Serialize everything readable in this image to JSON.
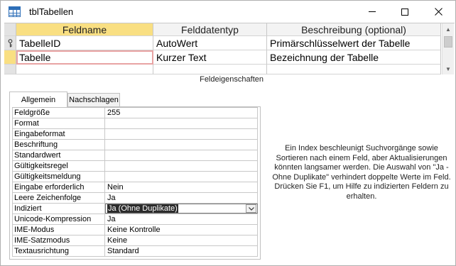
{
  "window": {
    "title": "tblTabellen",
    "icon": "table-icon"
  },
  "grid": {
    "headers": [
      "Feldname",
      "Felddatentyp",
      "Beschreibung (optional)"
    ],
    "rows": [
      {
        "field": "TabelleID",
        "type": "AutoWert",
        "description": "Primärschlüsselwert der Tabelle",
        "primary_key": true
      },
      {
        "field": "Tabelle",
        "type": "Kurzer Text",
        "description": "Bezeichnung der Tabelle",
        "primary_key": false
      }
    ],
    "accent_color": "#f9df82"
  },
  "section_label": "Feldeigenschaften",
  "tabs": {
    "general": "Allgemein",
    "lookup": "Nachschlagen"
  },
  "properties": [
    {
      "name": "Feldgröße",
      "value": "255"
    },
    {
      "name": "Format",
      "value": ""
    },
    {
      "name": "Eingabeformat",
      "value": ""
    },
    {
      "name": "Beschriftung",
      "value": ""
    },
    {
      "name": "Standardwert",
      "value": ""
    },
    {
      "name": "Gültigkeitsregel",
      "value": ""
    },
    {
      "name": "Gültigkeitsmeldung",
      "value": ""
    },
    {
      "name": "Eingabe erforderlich",
      "value": "Nein"
    },
    {
      "name": "Leere Zeichenfolge",
      "value": "Ja"
    },
    {
      "name": "Indiziert",
      "value": "Ja (Ohne Duplikate)"
    },
    {
      "name": "Unicode-Kompression",
      "value": "Ja"
    },
    {
      "name": "IME-Modus",
      "value": "Keine Kontrolle"
    },
    {
      "name": "IME-Satzmodus",
      "value": "Keine"
    },
    {
      "name": "Textausrichtung",
      "value": "Standard"
    }
  ],
  "help_text": "Ein Index beschleunigt Suchvorgänge sowie Sortieren nach einem Feld, aber Aktualisierungen könnten langsamer werden. Die Auswahl von \"Ja - Ohne Duplikate\" verhindert doppelte Werte im Feld. Drücken Sie F1, um Hilfe zu indizierten Feldern zu erhalten."
}
